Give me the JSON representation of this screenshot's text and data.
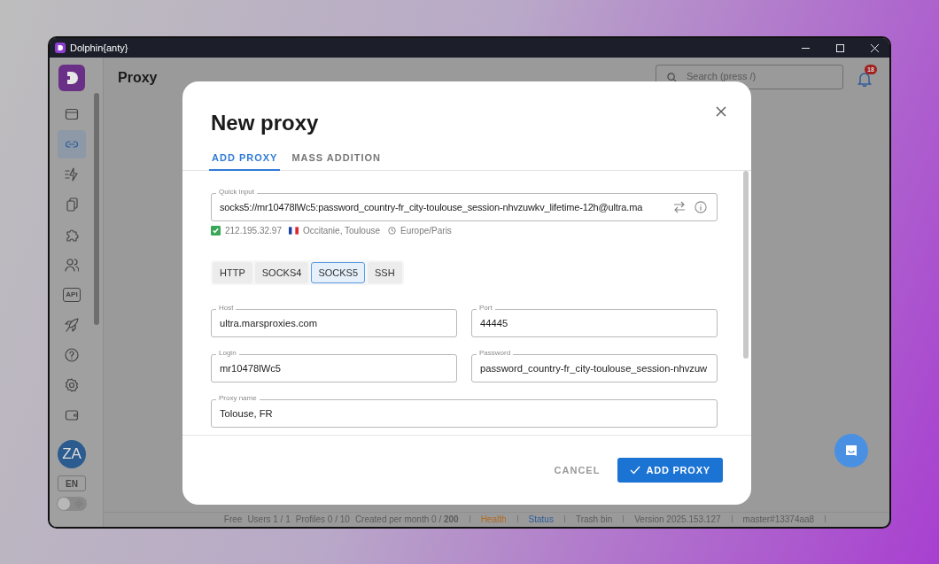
{
  "window": {
    "title": "Dolphin{anty}"
  },
  "sidebar": {
    "items": [
      {
        "kind": "window",
        "selected": false
      },
      {
        "kind": "link",
        "selected": true
      },
      {
        "kind": "flash",
        "selected": false
      },
      {
        "kind": "copy",
        "selected": false
      },
      {
        "kind": "puzzle",
        "selected": false
      },
      {
        "kind": "users",
        "selected": false
      },
      {
        "kind": "api",
        "selected": false,
        "text": "API"
      },
      {
        "kind": "rocket",
        "selected": false
      },
      {
        "kind": "help",
        "selected": false
      },
      {
        "kind": "settings",
        "selected": false
      },
      {
        "kind": "wallet",
        "selected": false
      }
    ],
    "avatar": "ZA",
    "language": "EN",
    "dark_theme": false
  },
  "page": {
    "title": "Proxy",
    "search": {
      "placeholder": "Search (press /)"
    },
    "notifications": "18"
  },
  "dialog": {
    "title": "New proxy",
    "tabs": [
      {
        "label": "ADD PROXY",
        "selected": true
      },
      {
        "label": "MASS ADDITION",
        "selected": false
      }
    ],
    "quick_input": {
      "label": "Quick input",
      "value": "socks5://mr10478lWc5:password_country-fr_city-toulouse_session-nhvzuwkv_lifetime-12h@ultra.ma"
    },
    "check": {
      "valid": true,
      "ip": "212.195.32.97",
      "location": "Occitanie, Toulouse",
      "timezone": "Europe/Paris"
    },
    "protocols": [
      {
        "label": "HTTP",
        "selected": false
      },
      {
        "label": "SOCKS4",
        "selected": false
      },
      {
        "label": "SOCKS5",
        "selected": true
      },
      {
        "label": "SSH",
        "selected": false
      }
    ],
    "fields": [
      {
        "label": "Host",
        "value": "ultra.marsproxies.com",
        "wide": false
      },
      {
        "label": "Port",
        "value": "44445",
        "wide": false
      },
      {
        "label": "Login",
        "value": "mr10478lWc5",
        "wide": false
      },
      {
        "label": "Password",
        "value": "password_country-fr_city-toulouse_session-nhvzuw",
        "wide": false
      },
      {
        "label": "Proxy name",
        "value": "Tolouse, FR",
        "wide": true
      }
    ],
    "buttons": {
      "cancel": "CANCEL",
      "submit": "ADD PROXY"
    }
  },
  "status_bar": [
    {
      "text": "Free",
      "color": "#5c5c5c",
      "divider_after": false
    },
    {
      "text": "Users 1 / 1",
      "color": "#5c5c5c",
      "divider_after": false
    },
    {
      "text": "Profiles 0 / 10",
      "color": "#5c5c5c",
      "divider_after": false
    },
    {
      "text": "Created per month 0 / **200**",
      "color": "#5c5c5c",
      "divider_after": true
    },
    {
      "text": "Health",
      "color": "#b06a1e",
      "divider_after": true
    },
    {
      "text": "Status",
      "color": "#2f5d9a",
      "divider_after": true
    },
    {
      "text": "Trash bin",
      "color": "#5c5c5c",
      "divider_after": true
    },
    {
      "text": "Version 2025.153.127",
      "color": "#5c5c5c",
      "divider_after": true
    },
    {
      "text": "master#13374aa8",
      "color": "#5c5c5c",
      "divider_after": true
    }
  ]
}
